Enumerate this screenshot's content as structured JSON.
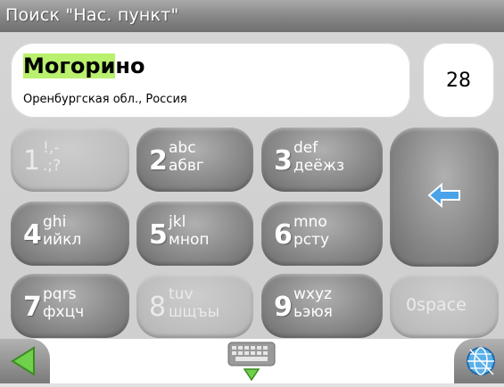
{
  "window": {
    "title": "Поиск \"Нас. пункт\""
  },
  "result": {
    "name_highlight": "Могори",
    "name_rest": "но",
    "region": "Оренбургская обл., Россия",
    "count": "28"
  },
  "keypad": {
    "keys": [
      {
        "digit": "1",
        "lat": "!,-",
        "cyr": ".;?",
        "enabled": false
      },
      {
        "digit": "2",
        "lat": "abc",
        "cyr": "абвг",
        "enabled": true
      },
      {
        "digit": "3",
        "lat": "def",
        "cyr": "деёжз",
        "enabled": true
      },
      {
        "digit": "4",
        "lat": "ghi",
        "cyr": "ийкл",
        "enabled": true
      },
      {
        "digit": "5",
        "lat": "jkl",
        "cyr": "мноп",
        "enabled": true
      },
      {
        "digit": "6",
        "lat": "mno",
        "cyr": "рсту",
        "enabled": true
      },
      {
        "digit": "7",
        "lat": "pqrs",
        "cyr": "фхцч",
        "enabled": true
      },
      {
        "digit": "8",
        "lat": "tuv",
        "cyr": "шщъы",
        "enabled": false
      },
      {
        "digit": "9",
        "lat": "wxyz",
        "cyr": "ьэюя",
        "enabled": true
      },
      {
        "digit": "0",
        "space": "space",
        "enabled": false
      }
    ],
    "backspace_icon": "backspace-arrow-icon"
  },
  "toolbar": {
    "back_icon": "back-triangle-icon",
    "keyboard_icon": "keyboard-icon",
    "globe_icon": "globe-icon"
  },
  "colors": {
    "highlight": "#b9f06e",
    "titlebar": "#858585",
    "key_enabled": "#8a8a8a",
    "key_disabled": "#bfbfbf",
    "back_arrow": "#6fd04a",
    "backspace_arrow": "#4aa3e8"
  }
}
